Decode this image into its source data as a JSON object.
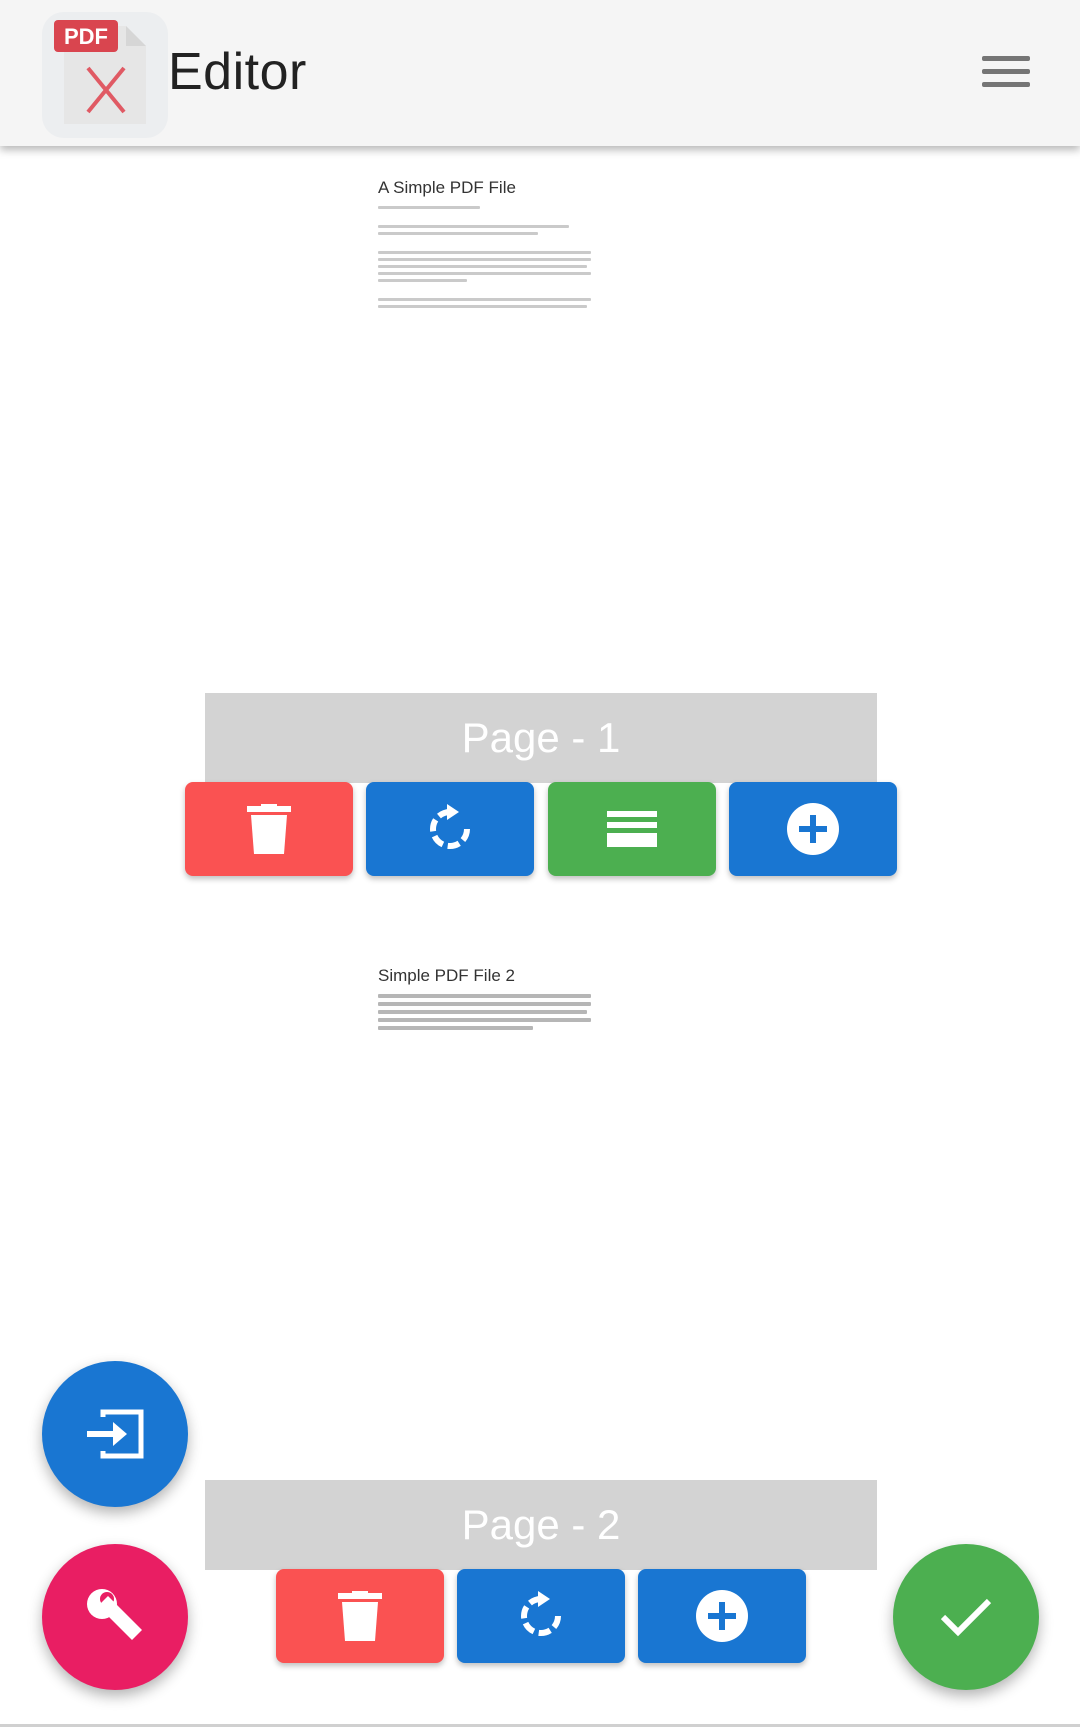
{
  "appbar": {
    "title": "Editor",
    "logo_badge": "PDF",
    "logo_icon": "pdf-x-logo",
    "menu_icon": "hamburger-menu-icon"
  },
  "pages": [
    {
      "preview_title": "A Simple PDF File",
      "label": "Page - 1",
      "actions": [
        "delete",
        "rotate",
        "reorder",
        "add"
      ]
    },
    {
      "preview_title": "Simple PDF File 2",
      "label": "Page - 2",
      "actions": [
        "delete",
        "rotate",
        "add"
      ]
    }
  ],
  "fabs": {
    "import_icon": "input-icon",
    "tools_icon": "wrench-icon",
    "confirm_icon": "check-icon"
  },
  "colors": {
    "delete": "#fa5252",
    "rotate": "#1976d2",
    "reorder": "#4caf50",
    "add": "#1976d2",
    "import_fab": "#1976d2",
    "tools_fab": "#e91e63",
    "confirm_fab": "#4caf50",
    "page_label_bg": "#d3d3d3"
  }
}
